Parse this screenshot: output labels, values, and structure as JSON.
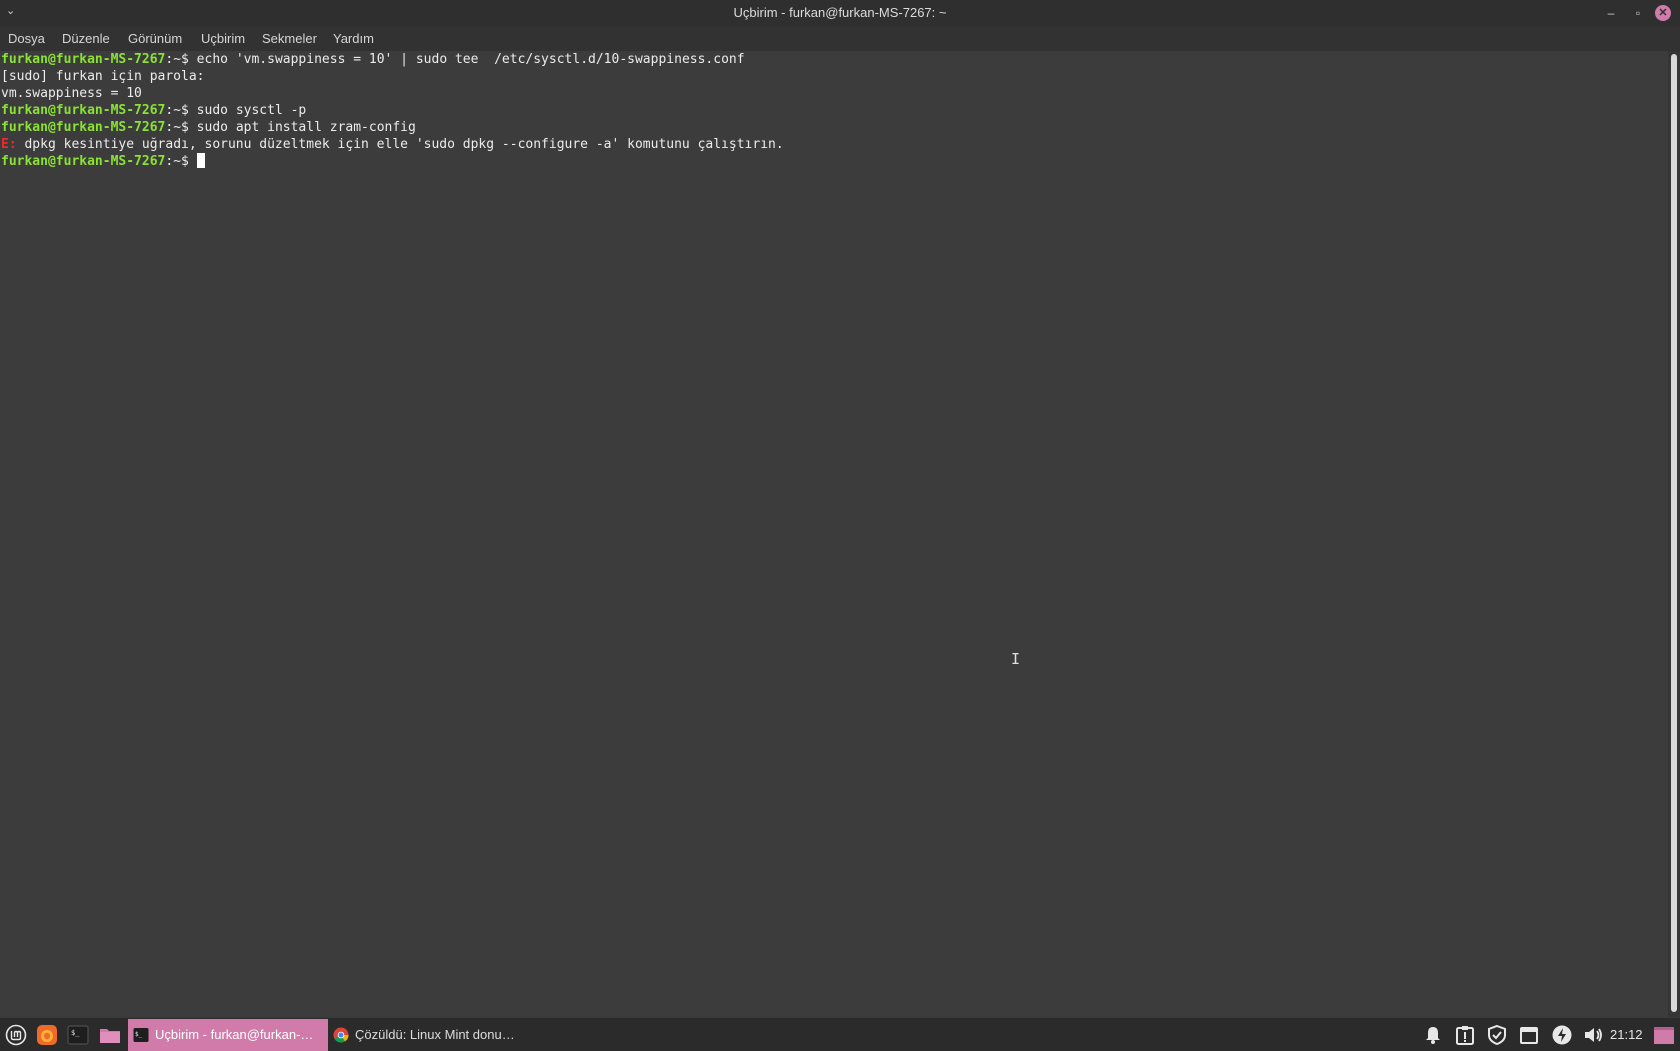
{
  "window": {
    "title": "Uçbirim - furkan@furkan-MS-7267: ~",
    "menu_glyph": "⌄"
  },
  "menubar": {
    "items": [
      "Dosya",
      "Düzenle",
      "Görünüm",
      "Uçbirim",
      "Sekmeler",
      "Yardım"
    ]
  },
  "terminal": {
    "prompt": "furkan@furkan-MS-7267",
    "prompt_suffix": ":~$",
    "lines": [
      {
        "kind": "cmd",
        "text": " echo 'vm.swappiness = 10' | sudo tee  /etc/sysctl.d/10-swappiness.conf"
      },
      {
        "kind": "out",
        "text": "[sudo] furkan için parola:"
      },
      {
        "kind": "out",
        "text": "vm.swappiness = 10"
      },
      {
        "kind": "cmd",
        "text": " sudo sysctl -p"
      },
      {
        "kind": "cmd",
        "text": " sudo apt install zram-config"
      },
      {
        "kind": "err",
        "prefix": "E:",
        "text": " dpkg kesintiye uğradı, sorunu düzeltmek için elle 'sudo dpkg --configure -a' komutunu çalıştırın."
      },
      {
        "kind": "cmd",
        "text": " "
      }
    ]
  },
  "taskbar": {
    "tasks": [
      {
        "label": "Uçbirim - furkan@furkan-…",
        "active": true
      },
      {
        "label": "Çözüldü: Linux Mint donu…",
        "active": false
      }
    ],
    "clock": "21:12"
  },
  "colors": {
    "accent": "#d07baa",
    "prompt": "#8ae234",
    "error": "#ef2929",
    "background": "#3c3c3c"
  },
  "icons": {
    "launcher": [
      "mint-menu-icon",
      "firefox-icon",
      "terminal-icon",
      "files-icon"
    ],
    "tray": [
      "notification-bell-icon",
      "clipboard-alert-icon",
      "shield-icon",
      "network-icon",
      "power-icon",
      "volume-icon",
      "show-desktop-icon"
    ]
  }
}
